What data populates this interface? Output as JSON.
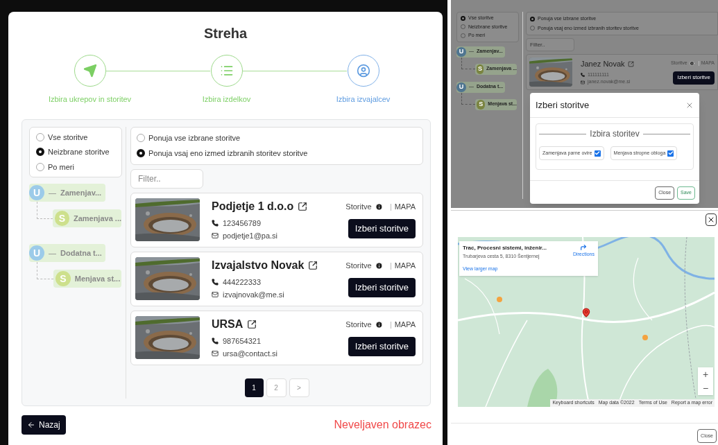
{
  "main": {
    "title": "Streha",
    "steps": [
      {
        "label": "Izbira ukrepov in storitev",
        "completed": true,
        "selected": false
      },
      {
        "label": "Izbira izdelkov",
        "completed": true,
        "selected": false
      },
      {
        "label": "Izbira izvajalcev",
        "completed": false,
        "selected": true
      }
    ],
    "scope_options": [
      {
        "label": "Vse storitve",
        "selected": false
      },
      {
        "label": "Neizbrane storitve",
        "selected": true
      },
      {
        "label": "Po meri",
        "selected": false
      }
    ],
    "tree": [
      {
        "badge": "U",
        "color": "#9ccbe9",
        "toggle": "—",
        "label": "Zamenjav...",
        "children": [
          {
            "badge": "S",
            "color": "#cde08c",
            "label": "Zamenjava ..."
          }
        ]
      },
      {
        "badge": "U",
        "color": "#9ccbe9",
        "toggle": "—",
        "label": "Dodatna t...",
        "children": [
          {
            "badge": "S",
            "color": "#cde08c",
            "label": "Menjava st..."
          }
        ]
      }
    ],
    "match_options": [
      {
        "label": "Ponuja vse izbrane storitve",
        "selected": false
      },
      {
        "label": "Ponuja vsaj eno izmed izbranih storitev storitve",
        "selected": true
      }
    ],
    "filter": {
      "placeholder": "Filter.."
    },
    "contractors": [
      {
        "name": "Podjetje 1 d.o.o",
        "phone": "123456789",
        "email": "podjetje1@pa.si",
        "services": "Storitve",
        "map": "MAPA",
        "button": "Izberi storitve"
      },
      {
        "name": "Izvajalstvo Novak",
        "phone": "444222333",
        "email": "izvajnovak@me.si",
        "services": "Storitve",
        "map": "MAPA",
        "button": "Izberi storitve"
      },
      {
        "name": "URSA",
        "phone": "987654321",
        "email": "ursa@contact.si",
        "services": "Storitve",
        "map": "MAPA",
        "button": "Izberi storitve"
      }
    ],
    "pagination": [
      {
        "label": "1",
        "selected": true
      },
      {
        "label": "2",
        "selected": false
      },
      {
        "label": ">",
        "selected": false
      }
    ],
    "back_button": "Nazaj",
    "error": "Neveljaven obrazec"
  },
  "background_page": {
    "scope_options": [
      {
        "label": "Vse storitve",
        "selected": true
      },
      {
        "label": "Neizbrane storitve",
        "selected": false
      },
      {
        "label": "Po meri",
        "selected": false
      }
    ],
    "tree": [
      {
        "badge": "U",
        "color": "#4f7590",
        "toggle": "—",
        "label": "Zamenjav...",
        "children": [
          {
            "badge": "S",
            "color": "#7a8440",
            "label": "Zamenjava ..."
          }
        ]
      },
      {
        "badge": "U",
        "color": "#4f7590",
        "toggle": "—",
        "label": "Dodatna t...",
        "children": [
          {
            "badge": "S",
            "color": "#7a8440",
            "label": "Menjava st..."
          }
        ]
      }
    ],
    "match_options": [
      {
        "label": "Ponuja vse izbrane storitve",
        "selected": true
      },
      {
        "label": "Ponuja vsaj eno izmed izbranih storitev storitve",
        "selected": false
      }
    ],
    "filter": {
      "placeholder": "Filter.."
    },
    "contractor": {
      "name": "Janez Novak",
      "phone": "111111111",
      "email": "janez.novak@me.si",
      "services": "Storitve",
      "map": "MAPA",
      "button": "Izberi storitve"
    }
  },
  "services_dialog": {
    "title": "Izberi storitve",
    "legend": "Izbira storitev",
    "options": [
      {
        "label": "Zamenjava parne ovire",
        "checked": true
      },
      {
        "label": "Menjava stropne obloga",
        "checked": true
      }
    ],
    "close_button": "Close",
    "save_button": "Save"
  },
  "map_dialog": {
    "place": {
      "name": "Trac, Procesni sistemi, inženir...",
      "address": "Trubarjeva cesta 5, 8310 Šentjernej",
      "directions": "Directions",
      "link": "View larger map"
    },
    "zoom_in": "+",
    "zoom_out": "−",
    "attribution": [
      "Keyboard shortcuts",
      "Map data ©2022",
      "Terms of Use",
      "Report a map error"
    ],
    "close_button": "Close"
  }
}
